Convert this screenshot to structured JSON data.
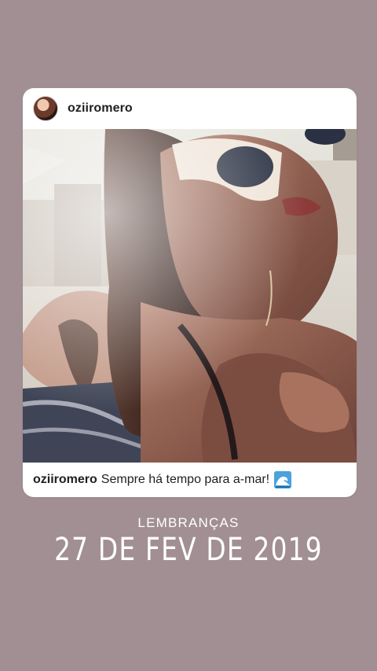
{
  "post": {
    "username": "oziiromero",
    "caption_user": "oziiromero",
    "caption_text": "Sempre há tempo para a-mar!",
    "caption_emoji": "water-wave-icon",
    "photo_description": "beach-selfie-photo"
  },
  "memories": {
    "label": "LEMBRANÇAS",
    "date": "27 DE FEV DE 2019"
  },
  "colors": {
    "background": "#a18f93",
    "card": "#ffffff",
    "text": "#1f1f1f",
    "overlay_text": "#ffffff",
    "emoji_blue": "#4aa3dc"
  }
}
